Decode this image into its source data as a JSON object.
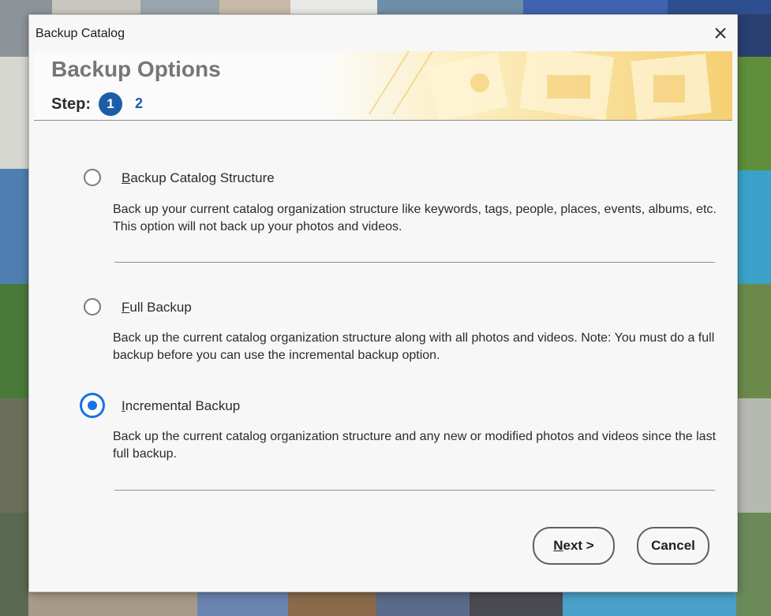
{
  "window": {
    "title": "Backup Catalog"
  },
  "header": {
    "title": "Backup Options",
    "step_label": "Step:",
    "steps": [
      "1",
      "2"
    ],
    "current_step": "1"
  },
  "options": [
    {
      "prefix": "",
      "accel": "B",
      "rest": "ackup Catalog Structure",
      "description": "Back up your current catalog organization structure like keywords, tags, people, places, events, albums, etc. This option will not back up your photos and videos.",
      "selected": false
    },
    {
      "prefix": "",
      "accel": "F",
      "rest": "ull Backup",
      "description": "Back up the current catalog organization structure along with all photos and videos. Note: You must do a full backup before you can use the incremental backup option.",
      "selected": false
    },
    {
      "prefix": "",
      "accel": "I",
      "rest": "ncremental Backup",
      "description": "Back up the current catalog organization structure and any new or modified photos and videos since the last full backup.",
      "selected": true
    }
  ],
  "buttons": {
    "next_accel": "N",
    "next_rest": "ext >",
    "cancel": "Cancel"
  },
  "icons": {
    "close": "close-icon"
  },
  "colors": {
    "accent": "#1473e6",
    "step_badge": "#1b5ea8"
  }
}
